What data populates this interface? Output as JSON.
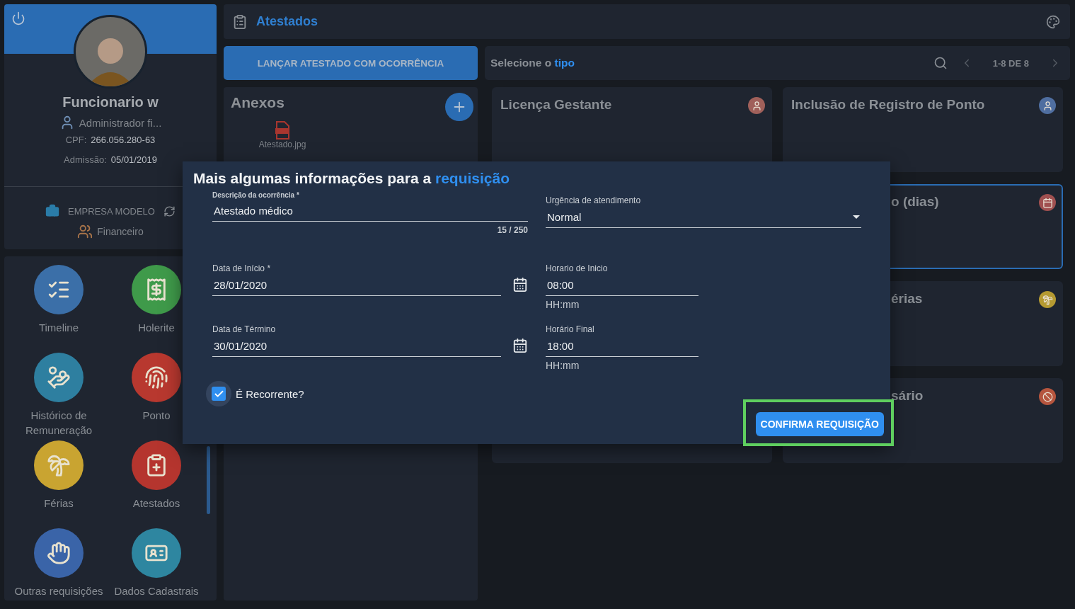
{
  "header": {
    "title": "Atestados"
  },
  "profile": {
    "name": "Funcionario w",
    "role": "Administrador fi...",
    "cpf_label": "CPF:",
    "cpf": "266.056.280-63",
    "admission_label": "Admissão:",
    "admission": "05/01/2019",
    "company": "EMPRESA MODELO",
    "department": "Financeiro"
  },
  "menu": [
    {
      "label": "Timeline",
      "color": "#3b6fa8"
    },
    {
      "label": "Holerite",
      "color": "#3f9a4a"
    },
    {
      "label": "Histórico de Remuneração",
      "color": "#2e7fa0"
    },
    {
      "label": "Ponto",
      "color": "#b8382f"
    },
    {
      "label": "Férias",
      "color": "#c9a431"
    },
    {
      "label": "Atestados",
      "color": "#b5352e"
    },
    {
      "label": "Outras requisições",
      "color": "#3a64a8"
    },
    {
      "label": "Dados Cadastrais",
      "color": "#2e86a0"
    }
  ],
  "launch_button": {
    "label": "LANÇAR ATESTADO COM OCORRÊNCIA"
  },
  "type_bar": {
    "prompt": "Selecione o",
    "highlight": "tipo",
    "pagination": "1-8 DE 8"
  },
  "attachments": {
    "title": "Anexos",
    "files": [
      {
        "name": "Atestado.jpg"
      }
    ]
  },
  "request_types": [
    {
      "kind": "full",
      "title": "Licença Gestante",
      "selected": false
    },
    {
      "kind": "full",
      "title": "Inclusão de Registro de Ponto",
      "selected": false
    },
    {
      "kind": "partial",
      "title": "o (dias)",
      "selected": true
    },
    {
      "kind": "partial",
      "title": "érias",
      "selected": false
    },
    {
      "kind": "blank"
    },
    {
      "kind": "partial",
      "title": "sário",
      "selected": false
    }
  ],
  "dialog": {
    "title": "Mais algumas informações para a",
    "title_highlight": "requisição",
    "description": {
      "label": "Descrição da ocorrência *",
      "value": "Atestado médico",
      "counter": "15 / 250"
    },
    "urgency": {
      "label": "Urgência de atendimento",
      "value": "Normal"
    },
    "start_date": {
      "label": "Data de Início *",
      "value": "28/01/2020"
    },
    "start_time": {
      "label": "Horario de Inicio",
      "value": "08:00",
      "hint": "HH:mm"
    },
    "end_date": {
      "label": "Data de Término",
      "value": "30/01/2020"
    },
    "end_time": {
      "label": "Horário Final",
      "value": "18:00",
      "hint": "HH:mm"
    },
    "recurring": {
      "label": "É Recorrente?",
      "checked": true
    },
    "confirm_button": {
      "label": "CONFIRMA REQUISIÇÃO",
      "highlighted": true
    }
  }
}
